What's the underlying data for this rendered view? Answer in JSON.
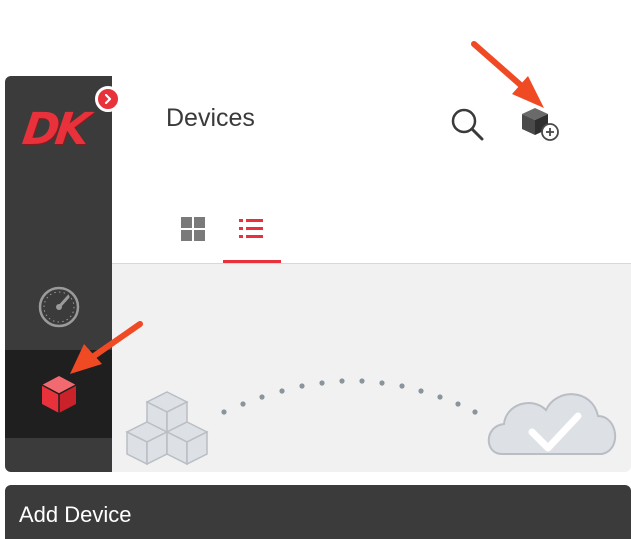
{
  "app": {
    "logo_text": "DK",
    "page_title": "Devices"
  },
  "sidebar": {
    "items": [
      {
        "name": "dashboard",
        "icon": "speedometer-icon"
      },
      {
        "name": "devices",
        "icon": "cube-icon",
        "active": true
      }
    ]
  },
  "header": {
    "search_icon": "search-icon",
    "add_device_icon": "add-device-icon"
  },
  "view_toggle": {
    "options": [
      "grid",
      "list"
    ],
    "selected": "list"
  },
  "bottom_bar": {
    "label": "Add Device"
  },
  "colors": {
    "accent": "#e8313a",
    "sidebar": "#3b3b3b",
    "sidebar_active": "#1f1f1f",
    "annotation_arrow": "#f04a25"
  }
}
